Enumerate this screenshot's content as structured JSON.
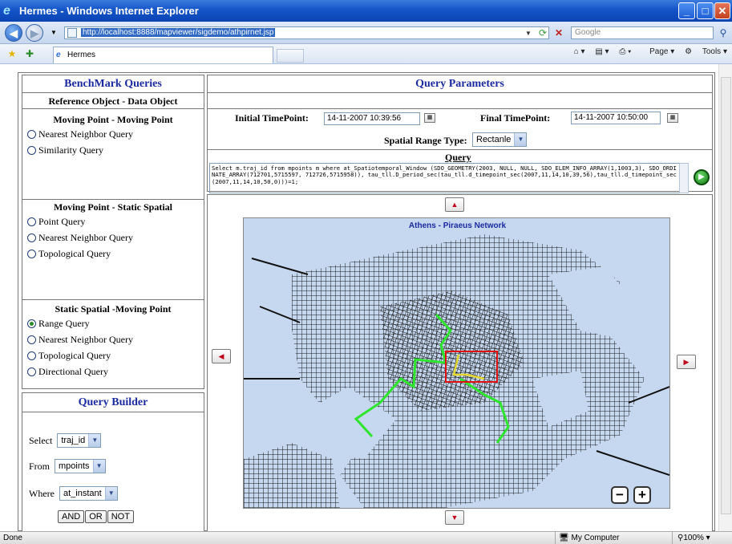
{
  "window": {
    "title": "Hermes - Windows Internet Explorer"
  },
  "browser": {
    "url": "http://localhost:8888/mapviewer/sigdemo/athpirnet.jsp",
    "search_placeholder": "Google",
    "tab_label": "Hermes",
    "tools": {
      "page": "Page",
      "tools": "Tools"
    }
  },
  "left": {
    "title": "BenchMark Queries",
    "subtitle": "Reference Object - Data Object",
    "sections": [
      {
        "title": "Moving Point - Moving Point",
        "options": [
          "Nearest Neighbor Query",
          "Similarity Query"
        ]
      },
      {
        "title": "Moving Point - Static Spatial",
        "options": [
          "Point Query",
          "Nearest Neighbor Query",
          "Topological Query"
        ]
      },
      {
        "title": "Static Spatial -Moving Point",
        "options": [
          "Range Query",
          "Nearest Neighbor Query",
          "Topological Query",
          "Directional Query"
        ],
        "selected": "Range Query"
      }
    ],
    "builder": {
      "title": "Query Builder",
      "select_label": "Select",
      "select_value": "traj_id",
      "from_label": "From",
      "from_value": "mpoints",
      "where_label": "Where",
      "where_value": "at_instant",
      "buttons": [
        "AND",
        "OR",
        "NOT"
      ]
    }
  },
  "params": {
    "title": "Query Parameters",
    "initial_label": "Initial TimePoint:",
    "initial_value": "14-11-2007 10:39:56",
    "final_label": "Final TimePoint:",
    "final_value": "14-11-2007 10:50:00",
    "spatial_label": "Spatial Range Type:",
    "spatial_value": "Rectanle",
    "query_label": "Query",
    "query_text": "Select m.traj_id from mpoints m where at_Spatiotemporal_Window (SDO_GEOMETRY(2003, NULL, NULL, SDO_ELEM_INFO_ARRAY(1,1003,3), SDO_ORDINATE_ARRAY(712701,5715597, 712726,5715958)), tau_tll.D_period_sec(tau_tll.d_timepoint_sec(2007,11,14,10,39,56),tau_tll.d_timepoint_sec (2007,11,14,10,50,0)))=1;"
  },
  "map": {
    "title": "Athens - Piraeus Network",
    "zoom_out": "−",
    "zoom_in": "+"
  },
  "status": {
    "left": "Done",
    "zone": "My Computer",
    "zoom": "100%"
  }
}
